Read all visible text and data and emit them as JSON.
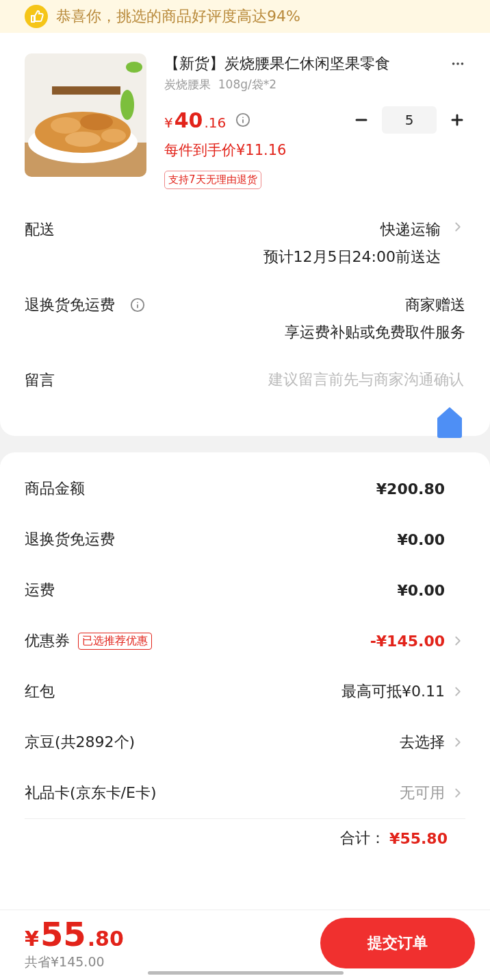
{
  "banner": {
    "text": "恭喜你，挑选的商品好评度高达94%"
  },
  "product": {
    "title": "【新货】炭烧腰果仁休闲坚果零食",
    "spec": "炭烧腰果  108g/袋*2",
    "price_symbol": "¥",
    "price_int": "40",
    "price_dec": ".16",
    "per_unit": "每件到手价¥11.16",
    "quantity": "5",
    "tag": "支持7天无理由退货"
  },
  "options": [
    {
      "kind": "info",
      "label": "配送",
      "info_icon": false,
      "value": "快递运输",
      "note": "预计12月5日24:00前送达",
      "chevron": true
    },
    {
      "kind": "info",
      "label": "退换货免运费",
      "info_icon": true,
      "value": "商家赠送",
      "note": "享运费补贴或免费取件服务",
      "chevron": false
    },
    {
      "kind": "input",
      "label": "留言",
      "placeholder": "建议留言前先与商家沟通确认"
    }
  ],
  "summary": [
    {
      "kind": "amount",
      "label": "商品金额",
      "value": "¥200.80"
    },
    {
      "kind": "amount",
      "label": "退换货免运费",
      "value": "¥0.00"
    },
    {
      "kind": "amount",
      "label": "运费",
      "value": "¥0.00"
    },
    {
      "kind": "discount",
      "label": "优惠券",
      "tag": "已选推荐优惠",
      "value": "-¥145.00"
    },
    {
      "kind": "option",
      "label": "红包",
      "value": "最高可抵¥0.11"
    },
    {
      "kind": "option",
      "label": "京豆(共2892个)",
      "value": "去选择"
    },
    {
      "kind": "unavailable",
      "label": "礼品卡(京东卡/E卡)",
      "value": "无可用"
    }
  ],
  "total": {
    "label": "合计：",
    "value": "¥55.80"
  },
  "footer": {
    "price_symbol": "¥",
    "price_int": "55",
    "price_dec": ".80",
    "saved": "共省¥145.00",
    "submit": "提交订单"
  }
}
